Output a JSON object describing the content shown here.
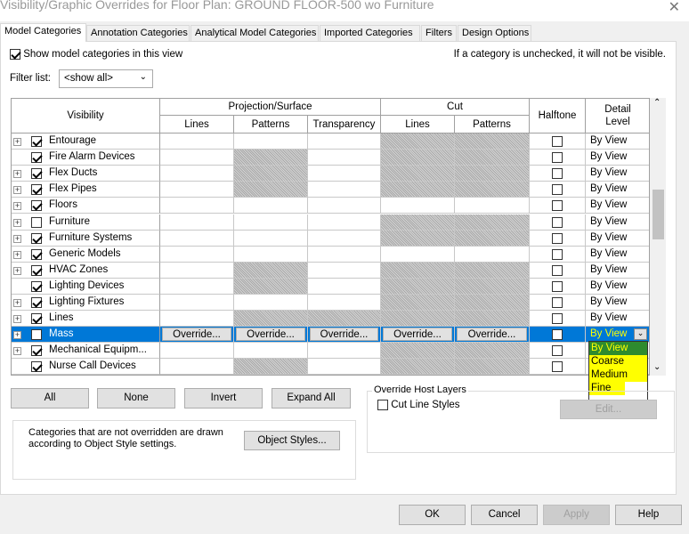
{
  "window": {
    "title": "Visibility/Graphic Overrides for Floor Plan: GROUND FLOOR-500 wo Furniture",
    "close": "✕"
  },
  "tabs": [
    "Model Categories",
    "Annotation Categories",
    "Analytical Model Categories",
    "Imported Categories",
    "Filters",
    "Design Options"
  ],
  "show_model": {
    "label": "Show model categories in this view",
    "checked": true
  },
  "hint": "If a category is unchecked, it will not be visible.",
  "filter": {
    "label": "Filter list:",
    "value": "<show all>"
  },
  "headers": {
    "visibility": "Visibility",
    "projection": "Projection/Surface",
    "cut": "Cut",
    "halftone": "Halftone",
    "detail": "Detail Level",
    "lines": "Lines",
    "patterns": "Patterns",
    "transparency": "Transparency",
    "cut_lines": "Lines",
    "cut_patterns": "Patterns"
  },
  "override_label": "Override...",
  "rows": [
    {
      "name": "Entourage",
      "checked": true,
      "expand": true,
      "hatch": [
        0,
        0,
        0,
        1,
        1
      ],
      "detail": "By View"
    },
    {
      "name": "Fire Alarm Devices",
      "checked": true,
      "expand": false,
      "hatch": [
        0,
        1,
        0,
        1,
        1
      ],
      "detail": "By View"
    },
    {
      "name": "Flex Ducts",
      "checked": true,
      "expand": true,
      "hatch": [
        0,
        1,
        0,
        1,
        1
      ],
      "detail": "By View"
    },
    {
      "name": "Flex Pipes",
      "checked": true,
      "expand": true,
      "hatch": [
        0,
        1,
        0,
        1,
        1
      ],
      "detail": "By View"
    },
    {
      "name": "Floors",
      "checked": true,
      "expand": true,
      "hatch": [
        0,
        0,
        0,
        0,
        0
      ],
      "detail": "By View"
    },
    {
      "name": "Furniture",
      "checked": false,
      "expand": true,
      "hatch": [
        0,
        0,
        0,
        1,
        1
      ],
      "detail": "By View"
    },
    {
      "name": "Furniture Systems",
      "checked": true,
      "expand": true,
      "hatch": [
        0,
        0,
        0,
        1,
        1
      ],
      "detail": "By View"
    },
    {
      "name": "Generic Models",
      "checked": true,
      "expand": true,
      "hatch": [
        0,
        0,
        0,
        0,
        0
      ],
      "detail": "By View"
    },
    {
      "name": "HVAC Zones",
      "checked": true,
      "expand": true,
      "hatch": [
        0,
        1,
        0,
        1,
        1
      ],
      "detail": "By View"
    },
    {
      "name": "Lighting Devices",
      "checked": true,
      "expand": false,
      "hatch": [
        0,
        1,
        0,
        1,
        1
      ],
      "detail": "By View"
    },
    {
      "name": "Lighting Fixtures",
      "checked": true,
      "expand": true,
      "hatch": [
        0,
        0,
        0,
        1,
        1
      ],
      "detail": "By View"
    },
    {
      "name": "Lines",
      "checked": true,
      "expand": true,
      "hatch": [
        0,
        1,
        1,
        1,
        1
      ],
      "detail": "By View"
    },
    {
      "name": "Mass",
      "checked": false,
      "expand": true,
      "selected": true,
      "hatch": [
        0,
        0,
        0,
        0,
        0
      ],
      "detail": "By View"
    },
    {
      "name": "Mechanical Equipm...",
      "checked": true,
      "expand": true,
      "hatch": [
        0,
        0,
        0,
        1,
        1
      ],
      "detail": ""
    },
    {
      "name": "Nurse Call Devices",
      "checked": true,
      "expand": false,
      "hatch": [
        0,
        1,
        0,
        1,
        1
      ],
      "detail": ""
    },
    {
      "name": "",
      "checked": false,
      "expand": true,
      "hatch": [
        0,
        0,
        0,
        1,
        1
      ],
      "detail": ""
    }
  ],
  "detail_dropdown": {
    "options": [
      "By View",
      "Coarse",
      "Medium",
      "Fine"
    ],
    "selected": "By View",
    "highlight": "#ffff00"
  },
  "buttons": {
    "all": "All",
    "none": "None",
    "invert": "Invert",
    "expand_all": "Expand All",
    "object_styles": "Object Styles...",
    "edit": "Edit...",
    "ok": "OK",
    "cancel": "Cancel",
    "apply": "Apply",
    "help": "Help"
  },
  "host_layers": {
    "title": "Override Host Layers",
    "cut_line_styles": "Cut Line Styles"
  },
  "note": "Categories that are not overridden are drawn according to Object Style settings."
}
